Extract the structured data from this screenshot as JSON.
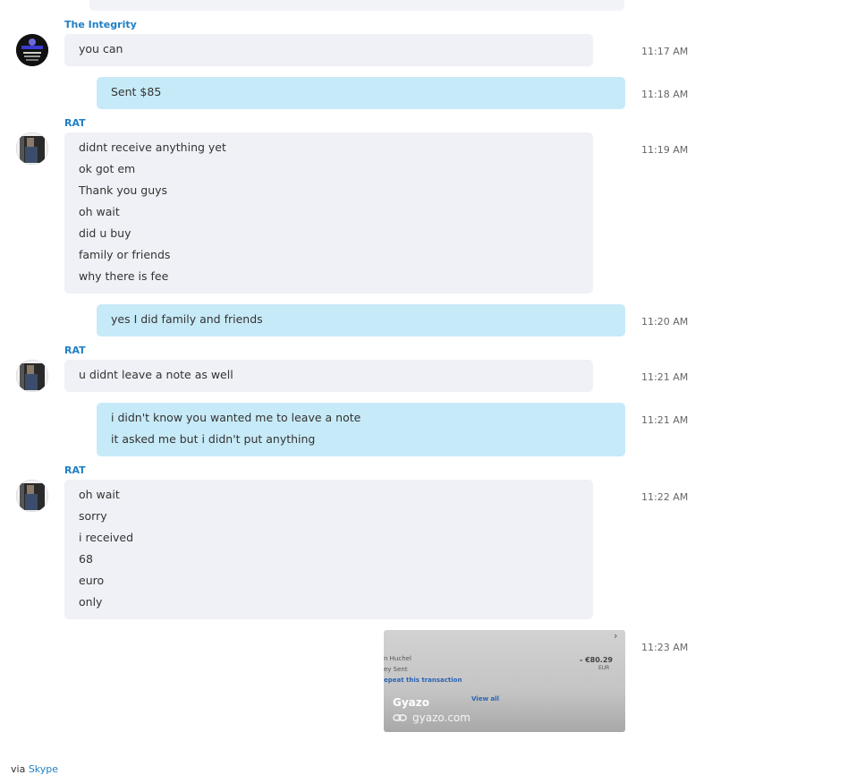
{
  "messages": [
    {
      "sender": "The Integrity",
      "direction": "in",
      "lines": [
        "you can"
      ],
      "time": "11:17 AM"
    },
    {
      "direction": "out",
      "lines": [
        "Sent $85"
      ],
      "time": "11:18 AM"
    },
    {
      "sender": "RAT",
      "direction": "in",
      "lines": [
        "didnt receive anything yet",
        "ok got em",
        "Thank you guys",
        "oh wait",
        "did u buy",
        "family or friends",
        "why there is fee"
      ],
      "time": "11:19 AM"
    },
    {
      "direction": "out",
      "lines": [
        "yes I did family and friends"
      ],
      "time": "11:20 AM"
    },
    {
      "sender": "RAT",
      "direction": "in",
      "lines": [
        "u didnt leave a note as well"
      ],
      "time": "11:21 AM"
    },
    {
      "direction": "out",
      "lines": [
        "i didn't know you wanted me to leave a note",
        "it asked me but i didn't put anything"
      ],
      "time": "11:21 AM"
    },
    {
      "sender": "RAT",
      "direction": "in",
      "lines": [
        "oh wait",
        "sorry",
        "i received",
        "68",
        "euro",
        "only"
      ],
      "time": "11:22 AM"
    }
  ],
  "avatars": {
    "integrity_text": "The Integrity",
    "integrity_color": "#4a4ad6"
  },
  "link_preview": {
    "time": "11:23 AM",
    "title": "Gyazo",
    "host": "gyazo.com",
    "thumb_name": "n Huchel",
    "thumb_status": "ey Sent",
    "thumb_repeat": "epeat this transaction",
    "thumb_amount": "- €80.29",
    "thumb_currency": "EUR",
    "thumb_view_all": "View all"
  },
  "footer": {
    "prefix": "via",
    "link": "Skype"
  },
  "colors": {
    "incoming_bubble": "#eff1f6",
    "outgoing_bubble": "#c7eaf8",
    "sender_name": "#1f7fc4"
  }
}
